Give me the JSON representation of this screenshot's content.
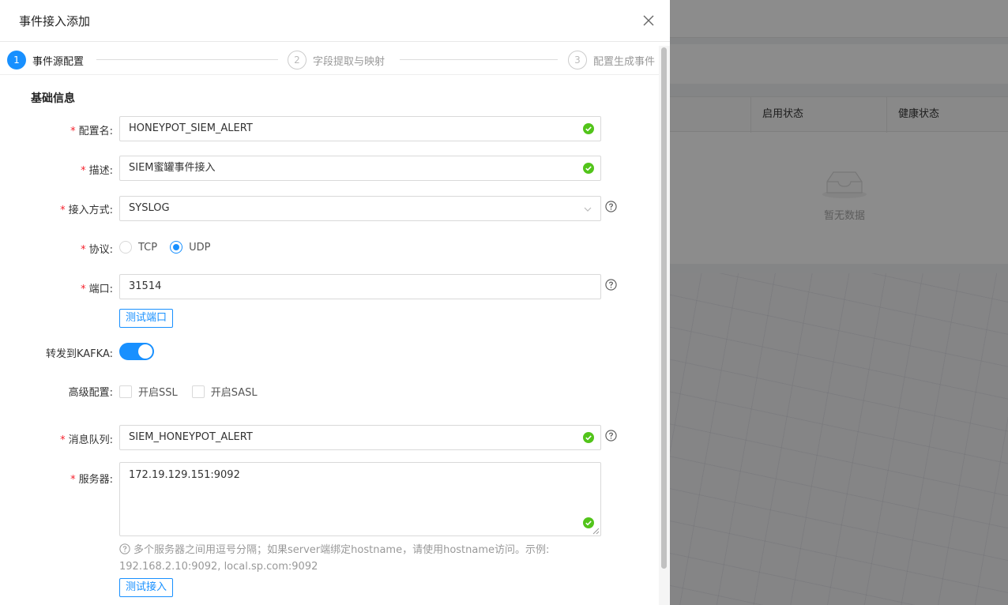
{
  "background": {
    "table_headers": [
      "启用状态",
      "健康状态"
    ],
    "empty_text": "暂无数据"
  },
  "drawer": {
    "title": "事件接入添加",
    "steps": [
      {
        "num": "1",
        "label": "事件源配置",
        "status": "active"
      },
      {
        "num": "2",
        "label": "字段提取与映射",
        "status": "wait"
      },
      {
        "num": "3",
        "label": "配置生成事件",
        "status": "wait"
      }
    ],
    "section_title": "基础信息",
    "form": {
      "config_name": {
        "label": "配置名:",
        "value": "HONEYPOT_SIEM_ALERT"
      },
      "description": {
        "label": "描述:",
        "value": "SIEM蜜罐事件接入"
      },
      "access_method": {
        "label": "接入方式:",
        "value": "SYSLOG"
      },
      "protocol": {
        "label": "协议:",
        "options": [
          "TCP",
          "UDP"
        ],
        "selected": "UDP"
      },
      "port": {
        "label": "端口:",
        "value": "31514",
        "test_button": "测试端口"
      },
      "forward_kafka": {
        "label": "转发到KAFKA:",
        "enabled": true
      },
      "advanced": {
        "label": "高级配置:",
        "options": [
          "开启SSL",
          "开启SASL"
        ]
      },
      "message_queue": {
        "label": "消息队列:",
        "value": "SIEM_HONEYPOT_ALERT"
      },
      "servers": {
        "label": "服务器:",
        "value": "172.19.129.151:9092",
        "hint_line1": "多个服务器之间用逗号分隔；如果server端绑定hostname，请使用hostname访问。示例:",
        "hint_line2": "192.168.2.10:9092, local.sp.com:9092",
        "test_button": "测试接入"
      }
    }
  },
  "colors": {
    "primary": "#1890ff",
    "success": "#52c41a",
    "required": "#f5222d"
  }
}
